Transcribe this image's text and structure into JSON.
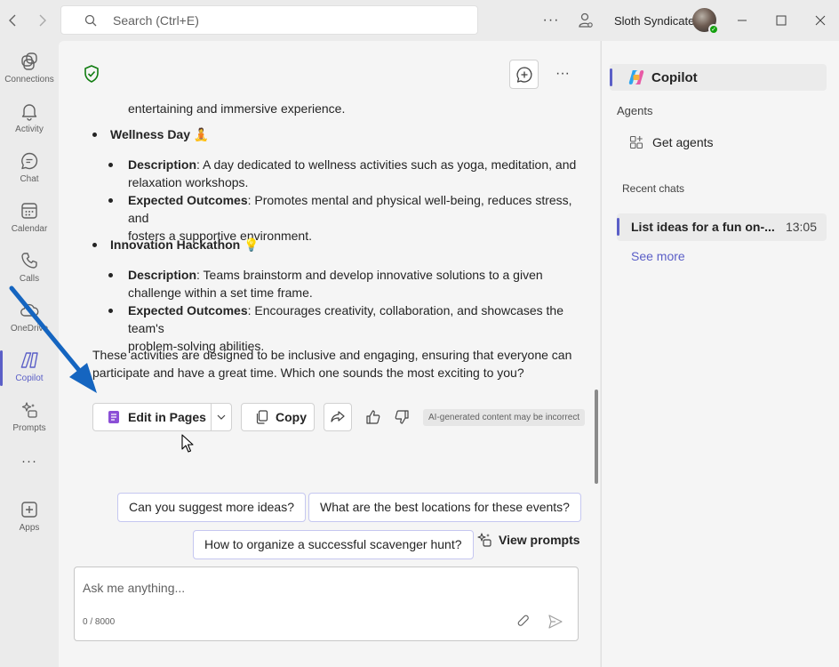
{
  "titlebar": {
    "search_placeholder": "Search (Ctrl+E)",
    "user_name": "Sloth Syndicate",
    "more_label": "···"
  },
  "rail": {
    "items": [
      {
        "label": "Connections",
        "icon": "connections-icon"
      },
      {
        "label": "Activity",
        "icon": "bell-icon"
      },
      {
        "label": "Chat",
        "icon": "chat-icon"
      },
      {
        "label": "Calendar",
        "icon": "calendar-icon"
      },
      {
        "label": "Calls",
        "icon": "phone-icon"
      },
      {
        "label": "OneDrive",
        "icon": "cloud-icon"
      },
      {
        "label": "Copilot",
        "icon": "copilot-icon",
        "active": true
      },
      {
        "label": "Prompts",
        "icon": "prompts-icon"
      },
      {
        "label": "···",
        "icon": "more-icon"
      },
      {
        "label": "Apps",
        "icon": "add-app-icon"
      }
    ]
  },
  "message": {
    "fragment": "entertaining and immersive experience.",
    "items": [
      {
        "title": "Wellness Day",
        "emoji": "🧘",
        "desc_label": "Description",
        "desc_line1": ": A day dedicated to wellness activities such as yoga, meditation, and",
        "desc_line2": "relaxation workshops.",
        "outcome_label": "Expected Outcomes",
        "outcome_line1": ": Promotes mental and physical well-being, reduces stress, and",
        "outcome_line2": "fosters a supportive environment."
      },
      {
        "title": "Innovation Hackathon",
        "emoji": "💡",
        "desc_label": "Description",
        "desc_line1": ": Teams brainstorm and develop innovative solutions to a given",
        "desc_line2": "challenge within a set time frame.",
        "outcome_label": "Expected Outcomes",
        "outcome_line1": ": Encourages creativity, collaboration, and showcases the team's",
        "outcome_line2": "problem-solving abilities."
      }
    ],
    "closing_line1": "These activities are designed to be inclusive and engaging, ensuring that everyone can",
    "closing_line2": "participate and have a great time. Which one sounds the most exciting to you?"
  },
  "actions": {
    "edit_in_pages": "Edit in Pages",
    "copy": "Copy",
    "ai_disclaimer": "AI-generated content may be incorrect"
  },
  "suggestions": [
    "Can you suggest more ideas?",
    "What are the best locations for these events?",
    "How to organize a successful scavenger hunt?"
  ],
  "view_prompts": "View prompts",
  "compose": {
    "placeholder": "Ask me anything...",
    "char_count": "0 / 8000"
  },
  "right_panel": {
    "copilot_label": "Copilot",
    "agents_heading": "Agents",
    "get_agents": "Get agents",
    "recent_heading": "Recent chats",
    "recent_chat_title": "List ideas for a fun on-...",
    "recent_chat_time": "13:05",
    "see_more": "See more"
  },
  "colors": {
    "accent": "#5b5fc7",
    "annotation_arrow": "#1565c0",
    "shield": "#107c10",
    "presence": "#13a10e"
  }
}
